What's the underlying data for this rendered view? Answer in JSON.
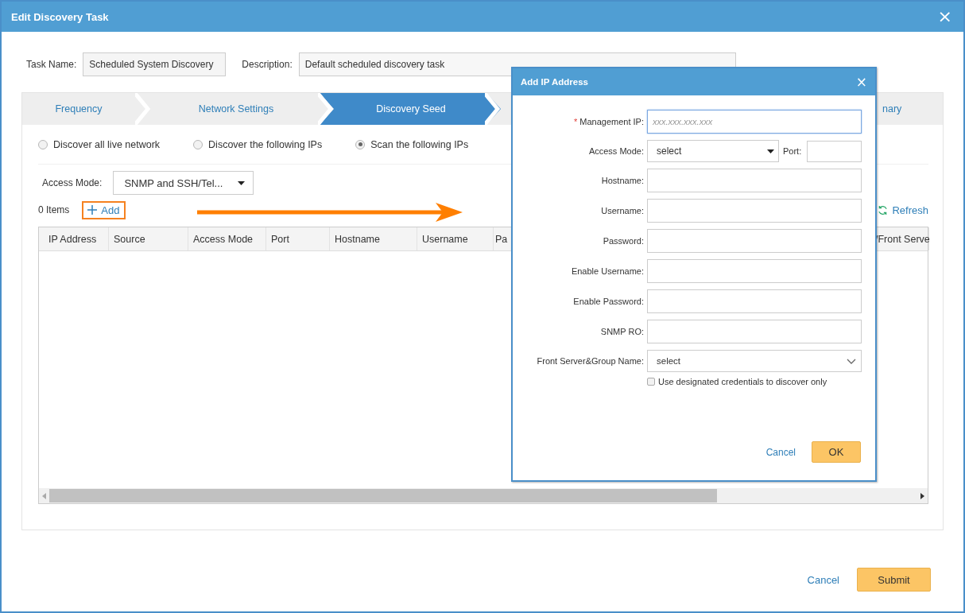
{
  "window": {
    "title": "Edit Discovery Task",
    "close": "×"
  },
  "task": {
    "name_label": "Task Name:",
    "name_value": "Scheduled System Discovery",
    "description_label": "Description:",
    "description_value": "Default scheduled discovery task"
  },
  "steps": [
    {
      "label": "Frequency",
      "selected": false
    },
    {
      "label": "Network Settings",
      "selected": false
    },
    {
      "label": "Discovery Seed",
      "selected": true
    },
    {
      "label": "nary",
      "selected": false
    }
  ],
  "radios": [
    {
      "label": "Discover all live network",
      "selected": false
    },
    {
      "label": "Discover the following IPs",
      "selected": false
    },
    {
      "label": "Scan the following IPs",
      "selected": true
    }
  ],
  "access_mode": {
    "label": "Access Mode:",
    "value": "SNMP and SSH/Tel..."
  },
  "items_count": "0 Items",
  "add_button": {
    "label": "Add",
    "highlighted": true
  },
  "refresh_button": "Refresh",
  "table": {
    "columns": [
      "IP Address",
      "Source",
      "Access Mode",
      "Port",
      "Hostname",
      "Username",
      "Pa",
      "/Front Serve"
    ]
  },
  "footer": {
    "cancel": "Cancel",
    "submit": "Submit"
  },
  "dialog": {
    "title": "Add IP Address",
    "close": "×",
    "fields": [
      {
        "kind": "text",
        "label": "Management IP:",
        "required_mark": "*",
        "placeholder": "xxx.xxx.xxx.xxx",
        "focused": true
      },
      {
        "kind": "select_port",
        "label": "Access Mode:",
        "value": "select",
        "port_label": "Port:"
      },
      {
        "kind": "text",
        "label": "Hostname:"
      },
      {
        "kind": "text",
        "label": "Username:"
      },
      {
        "kind": "text",
        "label": "Password:"
      },
      {
        "kind": "text",
        "label": "Enable Username:"
      },
      {
        "kind": "text",
        "label": "Enable Password:"
      },
      {
        "kind": "text",
        "label": "SNMP RO:"
      },
      {
        "kind": "dropdown",
        "label": "Front Server&Group Name:",
        "value": "select"
      }
    ],
    "checkbox": {
      "label": "Use designated credentials to discover only",
      "checked": false
    },
    "cancel": "Cancel",
    "ok": "OK"
  }
}
